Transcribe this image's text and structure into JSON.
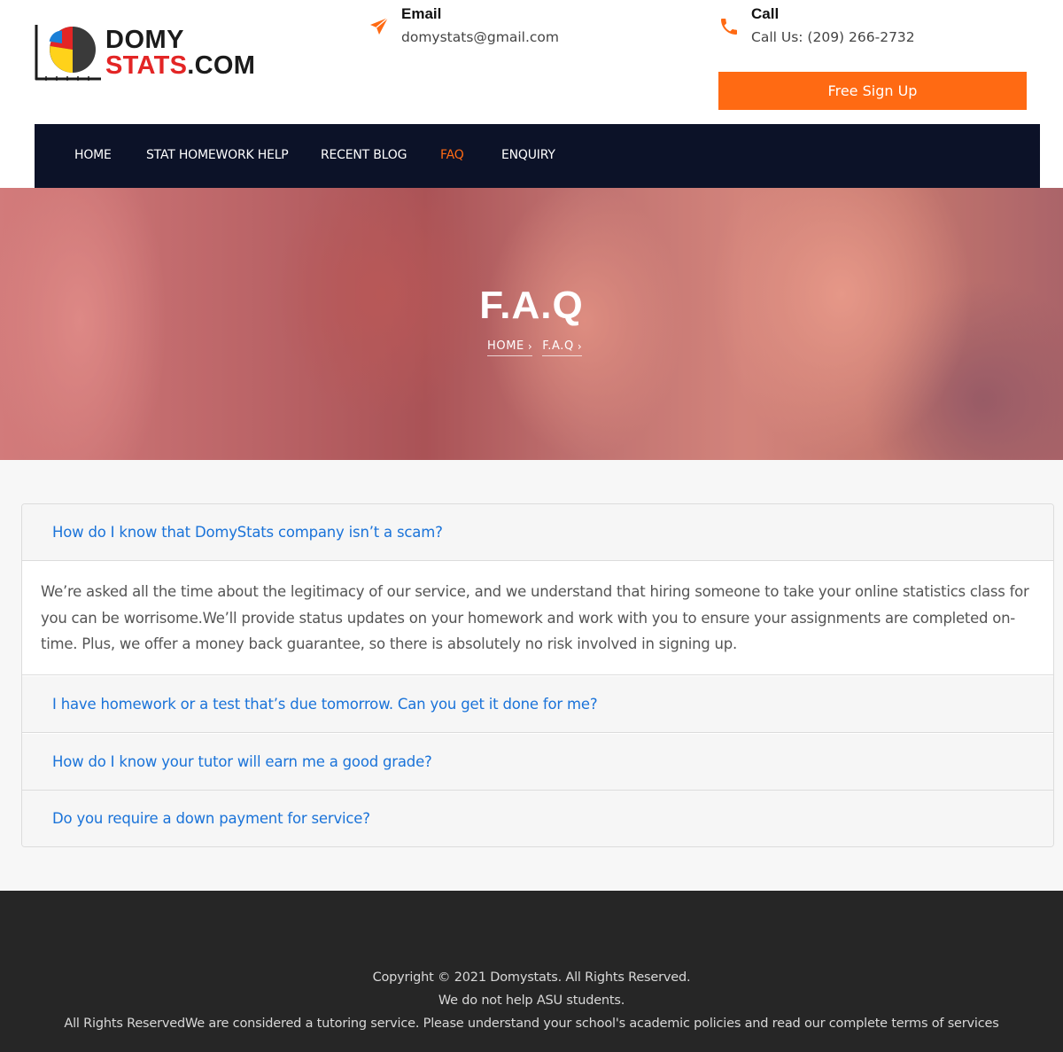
{
  "brand": {
    "logo_line1": "DOMY",
    "logo_line2_main": "STATS",
    "logo_line2_suffix": ".COM",
    "colors": {
      "accent": "#ff6a13",
      "navbar": "#0c1228",
      "link": "#1a73d9",
      "logo_red": "#e32525"
    }
  },
  "header": {
    "email": {
      "icon": "paper-plane-icon",
      "title": "Email",
      "value": "domystats@gmail.com"
    },
    "call": {
      "icon": "phone-icon",
      "title": "Call",
      "value": "Call Us: (209) 266-2732"
    },
    "signup_label": "Free Sign Up"
  },
  "nav": {
    "items": [
      {
        "label": "HOME",
        "active": false
      },
      {
        "label": "STAT HOMEWORK HELP",
        "active": false
      },
      {
        "label": "RECENT BLOG",
        "active": false
      },
      {
        "label": "FAQ",
        "active": true
      },
      {
        "label": "ENQUIRY",
        "active": false
      }
    ]
  },
  "hero": {
    "title": "F.A.Q",
    "breadcrumb": [
      "HOME",
      "F.A.Q"
    ]
  },
  "faq": {
    "items": [
      {
        "question": "How do I know that DomyStats company isn’t a scam?",
        "expanded": true,
        "answer": "We’re asked all the time about the legitimacy of our service, and we understand that hiring someone to take your online statistics class for you can be worrisome.We’ll provide status updates on your homework and work with you to ensure your assignments are completed on-time. Plus, we offer a money back guarantee, so there is absolutely no risk involved in signing up."
      },
      {
        "question": "I have homework or a test that’s due tomorrow. Can you get it done for me?",
        "expanded": false
      },
      {
        "question": "How do I know your tutor will earn me a good grade?",
        "expanded": false
      },
      {
        "question": "Do you require a down payment for service?",
        "expanded": false
      }
    ]
  },
  "footer": {
    "copyright": "Copyright © 2021 Domystats. All Rights Reserved.",
    "notice": "We do not help ASU students.",
    "disclaimer": "All Rights ReservedWe are considered a tutoring service. Please understand your school's academic policies and read our complete terms of services"
  }
}
